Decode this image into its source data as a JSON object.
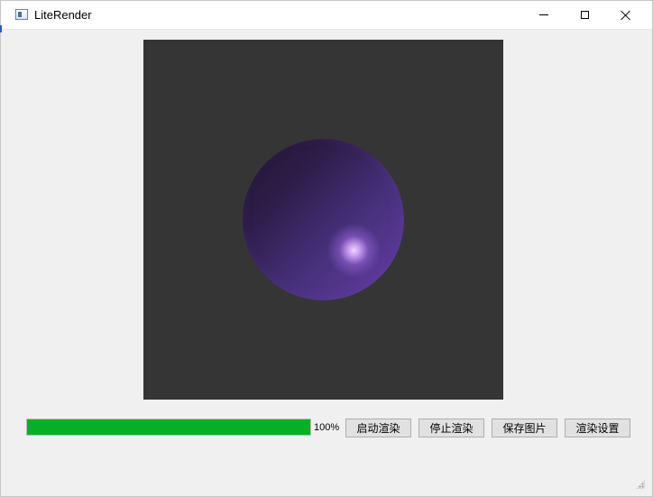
{
  "window": {
    "title": "LiteRender",
    "icon": "app-window-icon",
    "controls": {
      "minimize_icon": "minimize-icon",
      "maximize_icon": "maximize-icon",
      "close_icon": "close-icon"
    }
  },
  "render": {
    "background_color": "#353535",
    "sphere_color": "#5a3996",
    "highlight_color": "#e6c6ff"
  },
  "progress": {
    "value": 1.0,
    "label": "100%",
    "fill_color": "#06b025"
  },
  "buttons": {
    "start_render": "启动渲染",
    "stop_render": "停止渲染",
    "save_image": "保存图片",
    "render_settings": "渲染设置"
  }
}
